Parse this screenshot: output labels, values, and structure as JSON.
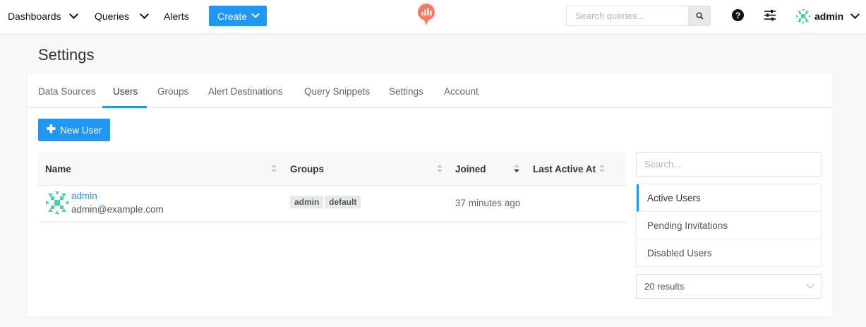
{
  "nav": {
    "dashboards": "Dashboards",
    "queries": "Queries",
    "alerts": "Alerts",
    "create": "Create",
    "search_placeholder": "Search queries...",
    "user": "admin"
  },
  "page": {
    "title": "Settings"
  },
  "tabs": [
    {
      "label": "Data Sources"
    },
    {
      "label": "Users"
    },
    {
      "label": "Groups"
    },
    {
      "label": "Alert Destinations"
    },
    {
      "label": "Query Snippets"
    },
    {
      "label": "Settings"
    },
    {
      "label": "Account"
    }
  ],
  "active_tab": "Users",
  "new_user_label": "New User",
  "table": {
    "columns": [
      "Name",
      "Groups",
      "Joined",
      "Last Active At"
    ],
    "rows": [
      {
        "name": "admin",
        "email": "admin@example.com",
        "groups": [
          "admin",
          "default"
        ],
        "joined": "37 minutes ago",
        "last_active": ""
      }
    ]
  },
  "side": {
    "search_placeholder": "Search...",
    "filters": [
      {
        "label": "Active Users"
      },
      {
        "label": "Pending Invitations"
      },
      {
        "label": "Disabled Users"
      }
    ],
    "results": "20 results"
  },
  "colors": {
    "accent": "#2196f3",
    "logo": "#ff7964",
    "avatar": "#4fd1a5"
  },
  "icons": [
    "chevron-down-icon",
    "search-icon",
    "help-icon",
    "settings-sliders-icon",
    "plus-icon",
    "sort-icon"
  ]
}
